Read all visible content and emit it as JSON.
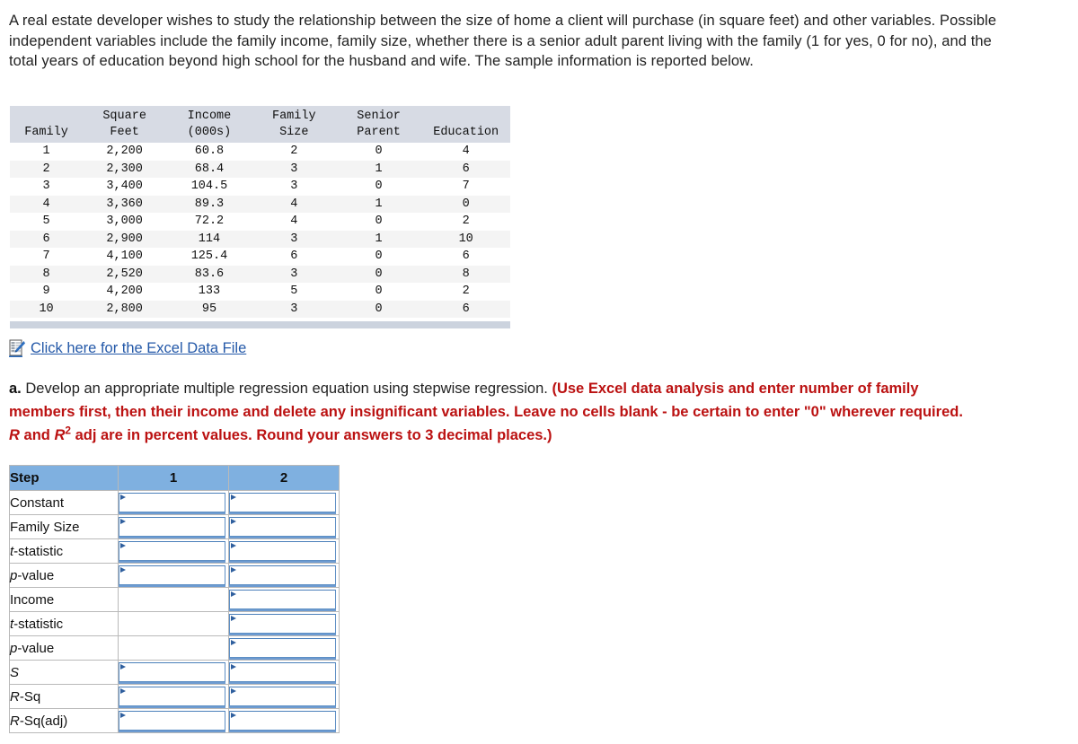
{
  "intro": {
    "paragraph": "A real estate developer wishes to study the relationship between the size of home a client will purchase (in square feet) and other variables. Possible independent variables include the family income, family size, whether there is a senior adult parent living with the family (1 for yes, 0 for no), and the total years of education beyond high school for the husband and wife. The sample information is reported below."
  },
  "data_table": {
    "headers_line1": [
      "",
      "Square",
      "Income",
      "Family",
      "Senior",
      ""
    ],
    "headers_line2": [
      "Family",
      "Feet",
      "(000s)",
      "Size",
      "Parent",
      "Education"
    ],
    "rows": [
      {
        "family": "1",
        "square_feet": "2,200",
        "income": "60.8",
        "family_size": "2",
        "senior_parent": "0",
        "education": "4"
      },
      {
        "family": "2",
        "square_feet": "2,300",
        "income": "68.4",
        "family_size": "3",
        "senior_parent": "1",
        "education": "6"
      },
      {
        "family": "3",
        "square_feet": "3,400",
        "income": "104.5",
        "family_size": "3",
        "senior_parent": "0",
        "education": "7"
      },
      {
        "family": "4",
        "square_feet": "3,360",
        "income": "89.3",
        "family_size": "4",
        "senior_parent": "1",
        "education": "0"
      },
      {
        "family": "5",
        "square_feet": "3,000",
        "income": "72.2",
        "family_size": "4",
        "senior_parent": "0",
        "education": "2"
      },
      {
        "family": "6",
        "square_feet": "2,900",
        "income": "114",
        "family_size": "3",
        "senior_parent": "1",
        "education": "10"
      },
      {
        "family": "7",
        "square_feet": "4,100",
        "income": "125.4",
        "family_size": "6",
        "senior_parent": "0",
        "education": "6"
      },
      {
        "family": "8",
        "square_feet": "2,520",
        "income": "83.6",
        "family_size": "3",
        "senior_parent": "0",
        "education": "8"
      },
      {
        "family": "9",
        "square_feet": "4,200",
        "income": "133",
        "family_size": "5",
        "senior_parent": "0",
        "education": "2"
      },
      {
        "family": "10",
        "square_feet": "2,800",
        "income": "95",
        "family_size": "3",
        "senior_parent": "0",
        "education": "6"
      }
    ]
  },
  "excel_link": {
    "icon": "excel-file-icon",
    "label": "Click here for the Excel Data File"
  },
  "question": {
    "letter": "a.",
    "black_text": "Develop an appropriate multiple regression equation using stepwise regression.",
    "red_text_1": "(Use Excel data analysis and enter number of family members first, then their income and delete any insignificant variables. Leave no cells blank - be certain to enter \"0\" wherever required.",
    "red_italic_r": "R",
    "red_mid_text": "and",
    "red_italic_r2": "R",
    "red_superscript": "2",
    "red_text_2": "adj are in percent values. Round your answers to 3 decimal places.)"
  },
  "step_table": {
    "columns": [
      "Step",
      "1",
      "2"
    ],
    "rows": [
      {
        "label": "Constant",
        "label_italic": "",
        "label_rest": "Constant",
        "col1": "input",
        "col2": "input"
      },
      {
        "label": "Family Size",
        "label_italic": "",
        "label_rest": "Family Size",
        "col1": "input",
        "col2": "input"
      },
      {
        "label": "t-statistic",
        "label_italic": "t",
        "label_rest": "-statistic",
        "col1": "input",
        "col2": "input"
      },
      {
        "label": "p-value",
        "label_italic": "p",
        "label_rest": "-value",
        "col1": "input",
        "col2": "input"
      },
      {
        "label": "Income",
        "label_italic": "",
        "label_rest": "Income",
        "col1": "empty",
        "col2": "input"
      },
      {
        "label": "t-statistic",
        "label_italic": "t",
        "label_rest": "-statistic",
        "col1": "empty",
        "col2": "input"
      },
      {
        "label": "p-value",
        "label_italic": "p",
        "label_rest": "-value",
        "col1": "empty",
        "col2": "input"
      },
      {
        "label": "S",
        "label_italic": "S",
        "label_rest": "",
        "col1": "input",
        "col2": "input"
      },
      {
        "label": "R-Sq",
        "label_italic": "R",
        "label_rest": "-Sq",
        "col1": "input",
        "col2": "input"
      },
      {
        "label": "R-Sq(adj)",
        "label_italic": "R",
        "label_rest": "-Sq(adj)",
        "col1": "input",
        "col2": "input"
      }
    ],
    "input_values": [
      "",
      "",
      "",
      "",
      "",
      "",
      "",
      "",
      "",
      "",
      "",
      "",
      "",
      "",
      "",
      "",
      ""
    ]
  },
  "colors": {
    "header_blue": "#7fb0e0",
    "data_header_gray": "#d7dbe4",
    "row_stripe": "#f4f4f4",
    "link_blue": "#2358a8",
    "red_instruction": "#bb1111",
    "input_border": "#5e8fc4",
    "footer_bar": "#ccd3de"
  }
}
